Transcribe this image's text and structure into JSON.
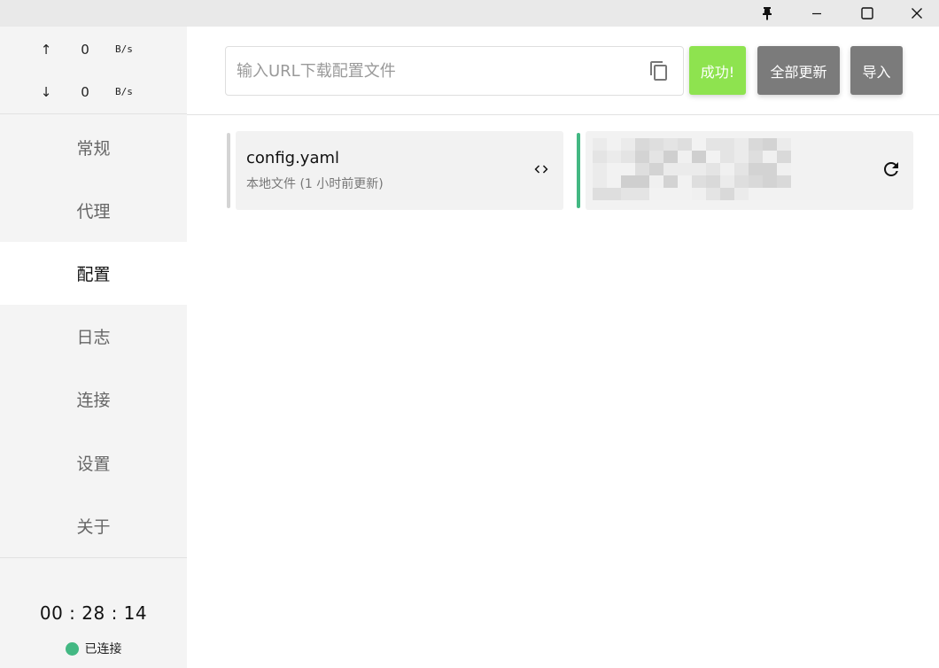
{
  "window": {
    "controls": [
      "pin-icon",
      "minimize-icon",
      "maximize-icon",
      "close-icon"
    ]
  },
  "traffic": {
    "up": {
      "arrow": "↑",
      "value": "0",
      "unit": "B/s"
    },
    "down": {
      "arrow": "↓",
      "value": "0",
      "unit": "B/s"
    }
  },
  "nav": {
    "items": [
      {
        "id": "general",
        "label": "常规"
      },
      {
        "id": "proxy",
        "label": "代理"
      },
      {
        "id": "profiles",
        "label": "配置"
      },
      {
        "id": "logs",
        "label": "日志"
      },
      {
        "id": "connections",
        "label": "连接"
      },
      {
        "id": "settings",
        "label": "设置"
      },
      {
        "id": "about",
        "label": "关于"
      }
    ],
    "active": "配置"
  },
  "footer": {
    "timer": "00 : 28 : 14",
    "status_label": "已连接",
    "status_color": "#43b883"
  },
  "header": {
    "url_placeholder": "输入URL下载配置文件",
    "url_value": "",
    "success_label": "成功!",
    "update_all_label": "全部更新",
    "import_label": "导入",
    "success_color": "#8ee34f",
    "button_color": "#7b7b7b"
  },
  "profiles": [
    {
      "name": "config.yaml",
      "desc": "本地文件 (1 小时前更新)",
      "action_icon": "code-icon",
      "selected": false
    },
    {
      "name": "",
      "desc": "",
      "action_icon": "refresh-icon",
      "selected": true,
      "redacted": true
    }
  ],
  "colors": {
    "accent": "#43b883",
    "sidebar_bg": "#f4f4f4",
    "card_bg": "#f2f2f2"
  }
}
